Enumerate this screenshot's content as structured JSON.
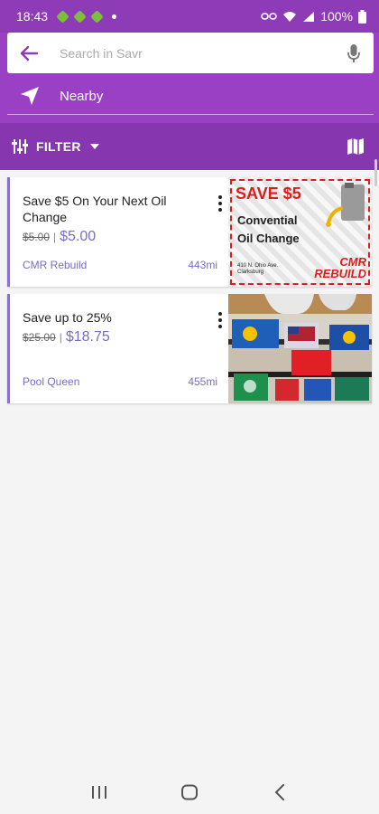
{
  "status_bar": {
    "time": "18:43",
    "battery": "100%"
  },
  "search": {
    "placeholder": "Search in Savr",
    "value": ""
  },
  "nearby": {
    "label": "Nearby"
  },
  "filter": {
    "label": "FILTER"
  },
  "deals": [
    {
      "title": "Save $5 On Your Next Oil Change",
      "old_price": "$5.00",
      "separator": "|",
      "new_price": "$5.00",
      "merchant": "CMR Rebuild",
      "distance": "443mi",
      "image": {
        "headline": "SAVE $5",
        "line1": "Convential",
        "line2": "Oil Change",
        "address_1": "410 N. Ohio Ave.",
        "address_2": "Clarksburg",
        "logo_1": "CMR",
        "logo_2": "REBUILD"
      }
    },
    {
      "title": "Save up to 25%",
      "old_price": "$25.00",
      "separator": "|",
      "new_price": "$18.75",
      "merchant": "Pool Queen",
      "distance": "455mi"
    }
  ],
  "colors": {
    "header": "#9a40c4",
    "filter_bar": "#8636ae",
    "accent": "#7a6cc4"
  },
  "icons": [
    "back-arrow-icon",
    "mic-icon",
    "navigation-arrow-icon",
    "filter-sliders-icon",
    "caret-down-icon",
    "map-icon",
    "more-vert-icon",
    "recents-icon",
    "home-icon",
    "back-icon"
  ]
}
